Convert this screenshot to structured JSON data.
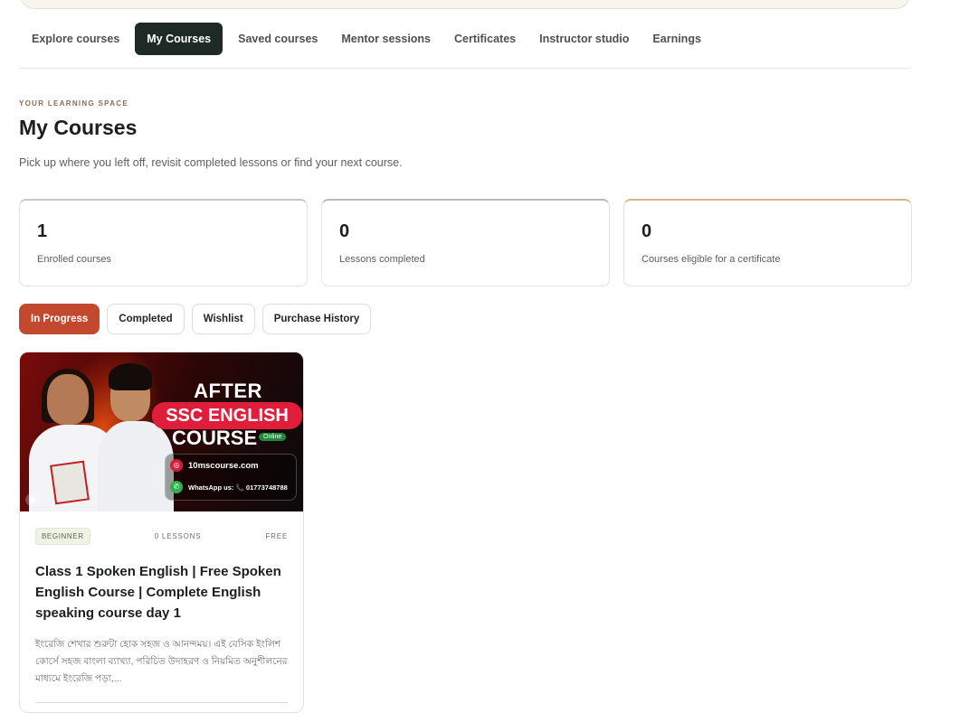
{
  "nav": {
    "items": [
      {
        "label": "Explore courses",
        "active": false
      },
      {
        "label": "My Courses",
        "active": true
      },
      {
        "label": "Saved courses",
        "active": false
      },
      {
        "label": "Mentor sessions",
        "active": false
      },
      {
        "label": "Certificates",
        "active": false
      },
      {
        "label": "Instructor studio",
        "active": false
      },
      {
        "label": "Earnings",
        "active": false
      }
    ]
  },
  "header": {
    "eyebrow": "YOUR LEARNING SPACE",
    "title": "My Courses",
    "subtitle": "Pick up where you left off, revisit completed lessons or find your next course."
  },
  "stats": [
    {
      "value": "1",
      "label": "Enrolled courses"
    },
    {
      "value": "0",
      "label": "Lessons completed"
    },
    {
      "value": "0",
      "label": "Courses eligible for a certificate"
    }
  ],
  "filters": [
    {
      "label": "In Progress",
      "active": true
    },
    {
      "label": "Completed",
      "active": false
    },
    {
      "label": "Wishlist",
      "active": false
    },
    {
      "label": "Purchase History",
      "active": false
    }
  ],
  "course": {
    "thumbnail": {
      "line1": "AFTER",
      "line2": "SSC ENGLISH",
      "line3": "COURSE",
      "online_tag": "Online",
      "website": "10mscourse.com",
      "whatsapp": "WhatsApp us: 📞 01773748788"
    },
    "level": "BEGINNER",
    "lessons": "0 LESSONS",
    "price": "FREE",
    "title": "Class 1 Spoken English | Free Spoken English Course | Complete English speaking course day 1",
    "description": "ইংরেজি শেখার শুরুটা হোক সহজ ও আনন্দময়। এই বেসিক ইংলিশ কোর্সে সহজ বাংলা ব্যাখ্যা, পরিচিত উদাহরণ ও নিয়মিত অনুশীলনের মাধ্যমে ইংরেজি পড়া,..."
  },
  "colors": {
    "accent": "#c2492e",
    "nav_active_bg": "#1f2a27"
  }
}
